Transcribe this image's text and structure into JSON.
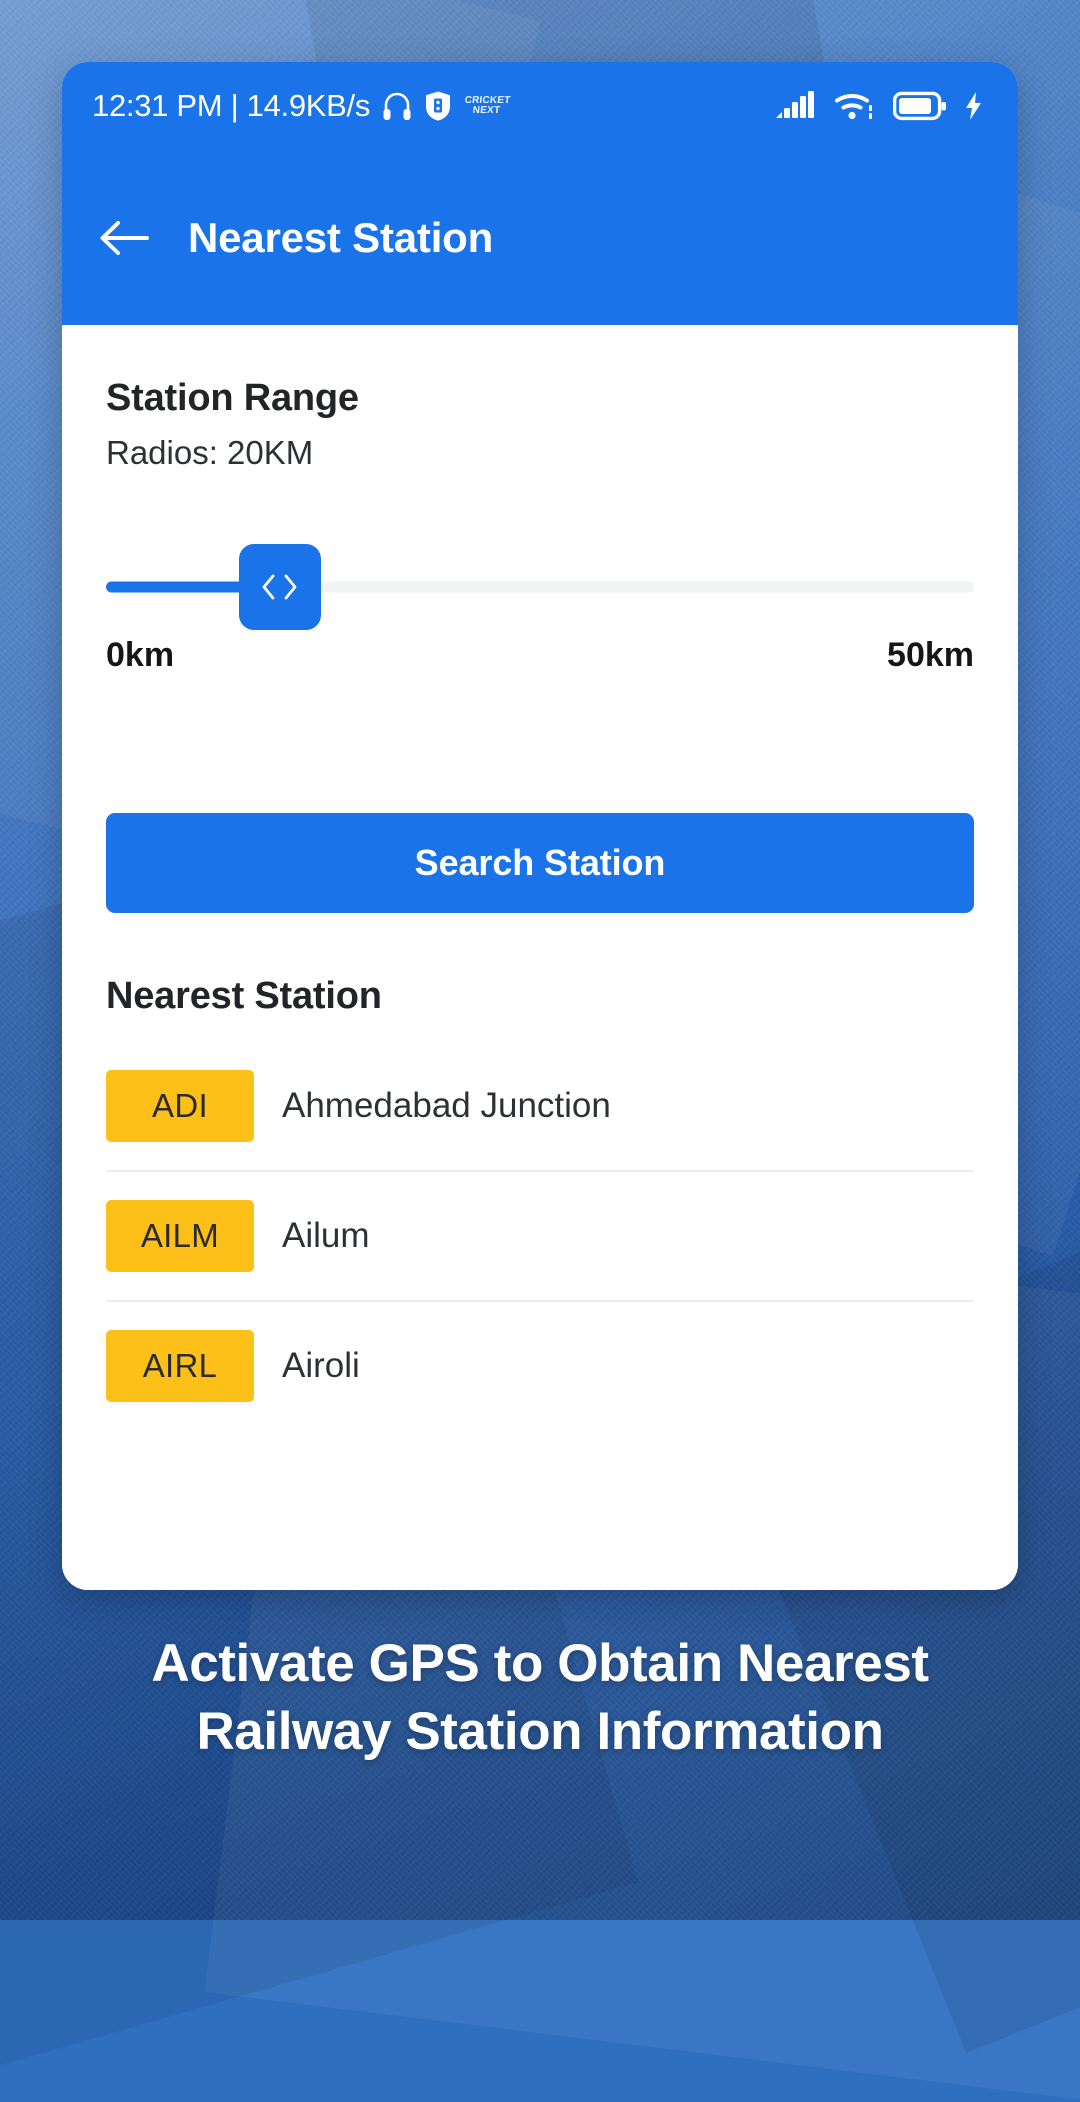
{
  "status_bar": {
    "clock_text": "12:31 PM | 14.9KB/s",
    "headphone_icon": "headphone-icon",
    "shield_icon": "shield-icon",
    "cricket_line1": "CRICKET",
    "cricket_line2": "NEXT",
    "signal_icon": "signal-bars-icon",
    "wifi_icon": "wifi-icon",
    "battery_icon": "battery-icon",
    "charging_icon": "charging-bolt-icon"
  },
  "app_bar": {
    "back_icon": "back-arrow-icon",
    "title": "Nearest Station"
  },
  "range": {
    "section_title": "Station Range",
    "radius_label": "Radios: 20KM",
    "slider": {
      "value": 20,
      "min": 0,
      "max": 50,
      "min_label": "0km",
      "max_label": "50km",
      "thumb_left_chevron": "‹",
      "thumb_right_chevron": "›",
      "fill_percent": 20
    }
  },
  "actions": {
    "search_button_label": "Search Station"
  },
  "results": {
    "list_title": "Nearest Station",
    "stations": [
      {
        "code": "ADI",
        "name": "Ahmedabad Junction"
      },
      {
        "code": "AILM",
        "name": "Ailum"
      },
      {
        "code": "AIRL",
        "name": "Airoli"
      }
    ]
  },
  "caption": {
    "line1": "Activate GPS to Obtain Nearest",
    "line2": "Railway Station Information"
  },
  "colors": {
    "brand_blue": "#1a73e8",
    "badge_amber": "#fcc019",
    "track_grey": "#f2f3f5",
    "text_dark": "#222428",
    "backdrop_blue": "#2f6fc0"
  }
}
